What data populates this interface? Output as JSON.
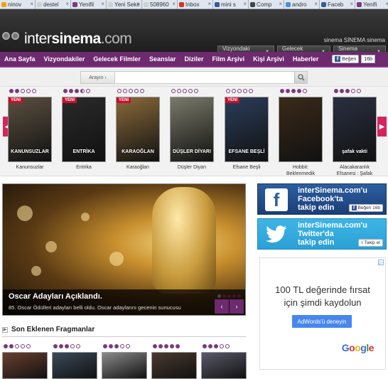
{
  "browser_tabs": [
    {
      "label": "ninov",
      "color": "#f2a300"
    },
    {
      "label": "destel",
      "color": "#d0d0d0"
    },
    {
      "label": "Yenifil",
      "color": "#7a3b7c"
    },
    {
      "label": "Yeni Seke",
      "color": "#d0d0d0"
    },
    {
      "label": "508960",
      "color": "#d0d0d0"
    },
    {
      "label": "Inbox",
      "color": "#d93025"
    },
    {
      "label": "mini s",
      "color": "#3b5998"
    },
    {
      "label": "Comp",
      "color": "#444444"
    },
    {
      "label": "andro",
      "color": "#4a90d9"
    },
    {
      "label": "Faceb",
      "color": "#3b5998"
    },
    {
      "label": "Yenifi",
      "color": "#7a3b7c"
    }
  ],
  "site": {
    "logo_main": "inter",
    "logo_bold": "sinema",
    "logo_suffix": ".com",
    "brand_link": "sinema SİNEMA sinema"
  },
  "header_selects": [
    {
      "label": "Vizyondaki Filmler"
    },
    {
      "label": "Gelecek Filmler"
    },
    {
      "label": "Sinema Salonları"
    }
  ],
  "nav": {
    "items": [
      "Ana Sayfa",
      "Vizyondakiler",
      "Gelecek Filmler",
      "Seanslar",
      "Diziler",
      "Film Arşivi",
      "Kişi Arşivi",
      "Haberler"
    ],
    "like_label": "Beğen",
    "like_count": "16b"
  },
  "search": {
    "label": "Arayın",
    "placeholder": ""
  },
  "carousel": {
    "badge": "YENİ",
    "movies": [
      {
        "title": "Kanunsuzlar",
        "yeni": true,
        "rating": 2,
        "poster_color": "#5b5040",
        "poster_text": "KANUNSUZLAR"
      },
      {
        "title": "Entrika",
        "yeni": true,
        "rating": 3.5,
        "poster_color": "#2a2a2a",
        "poster_text": "ENTRİKA"
      },
      {
        "title": "Karaoğlan",
        "yeni": true,
        "rating": 0,
        "poster_color": "#8a6a3a",
        "poster_text": "KARAOĞLAN"
      },
      {
        "title": "Düşler Diyarı",
        "yeni": false,
        "rating": 0,
        "poster_color": "#7a7a6a",
        "poster_text": "DÜŞLER DİYARI"
      },
      {
        "title": "Efsane Beşli",
        "yeni": true,
        "rating": 0,
        "poster_color": "#2b3d5a",
        "poster_text": "EFSANE BEŞLİ"
      },
      {
        "title": "Hobbit: Beklenmedik",
        "yeni": false,
        "rating": 4,
        "poster_color": "#3a2a1a",
        "poster_text": ""
      },
      {
        "title": "Alacakaranlık Efsanesi : Şafak",
        "yeni": false,
        "rating": 3,
        "poster_color": "#2a3040",
        "poster_text": "şafak vakti"
      }
    ]
  },
  "feature": {
    "title": "Oscar Adayları Açıklandı.",
    "desc": "85. Oscar Ödülleri adayları belli oldu. Oscar adaylarını gecenin sunucusu",
    "prev": "‹",
    "next": "›"
  },
  "social": {
    "facebook": {
      "line1": "interSinema.com'u",
      "line2": "Facebook'ta",
      "line3": "takip edin",
      "btn": "Beğen",
      "count": "16b"
    },
    "twitter": {
      "line1": "interSinema.com'u",
      "line2": "Twitter'da",
      "line3": "takip edin",
      "btn": "Takip et"
    }
  },
  "ad": {
    "headline1": "100 TL değerinde fırsat",
    "headline2": "için şimdi kaydolun",
    "cta": "AdWords'ü deneyin",
    "brand": [
      "G",
      "o",
      "o",
      "g",
      "l",
      "e"
    ]
  },
  "trailers": {
    "title": "Son Eklenen Fragmanlar",
    "items": [
      {
        "color": "#6a4030"
      },
      {
        "color": "#3a4a5a"
      },
      {
        "color": "#8a8a8a"
      },
      {
        "color": "#4a3a30"
      },
      {
        "color": "#5a5a6a"
      }
    ]
  }
}
